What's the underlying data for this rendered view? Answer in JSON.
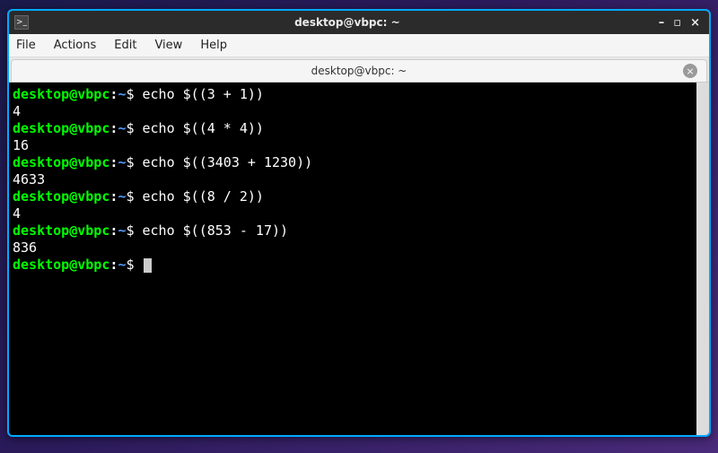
{
  "window": {
    "title": "desktop@vbpc: ~"
  },
  "menubar": {
    "items": [
      "File",
      "Actions",
      "Edit",
      "View",
      "Help"
    ]
  },
  "tab": {
    "label": "desktop@vbpc: ~"
  },
  "prompt": {
    "user_host": "desktop@vbpc",
    "sep": ":",
    "path": "~",
    "dollar": "$"
  },
  "lines": [
    {
      "type": "cmd",
      "text": "echo $((3 + 1))"
    },
    {
      "type": "out",
      "text": "4"
    },
    {
      "type": "cmd",
      "text": "echo $((4 * 4))"
    },
    {
      "type": "out",
      "text": "16"
    },
    {
      "type": "cmd",
      "text": "echo $((3403 + 1230))"
    },
    {
      "type": "out",
      "text": "4633"
    },
    {
      "type": "cmd",
      "text": "echo $((8 / 2))"
    },
    {
      "type": "out",
      "text": "4"
    },
    {
      "type": "cmd",
      "text": "echo $((853 - 17))"
    },
    {
      "type": "out",
      "text": "836"
    },
    {
      "type": "cursor"
    }
  ],
  "colors": {
    "prompt_user": "#00ff00",
    "prompt_path": "#4f9cff",
    "window_border": "#00aaff"
  }
}
